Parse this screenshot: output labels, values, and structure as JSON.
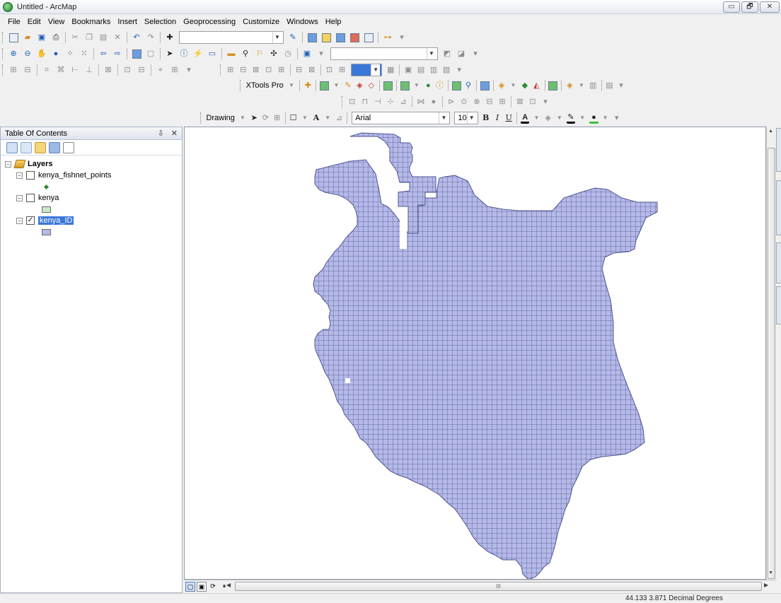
{
  "window": {
    "title": "Untitled - ArcMap",
    "controls": [
      "▭",
      "🗗",
      "✕"
    ]
  },
  "menu": [
    "File",
    "Edit",
    "View",
    "Bookmarks",
    "Insert",
    "Selection",
    "Geoprocessing",
    "Customize",
    "Windows",
    "Help"
  ],
  "toolbars": {
    "scale_combo_value": "",
    "xtools_label": "XTools Pro",
    "drawing_label": "Drawing",
    "font_name": "Arial",
    "font_size": "10",
    "bold": "B",
    "italic": "I",
    "underline": "U",
    "font_color_glyph": "A",
    "ellipsis": "..."
  },
  "toc": {
    "title": "Table Of Contents",
    "pin": "⇩",
    "close": "✕",
    "root": {
      "label": "Layers",
      "expander": "−"
    },
    "layers": [
      {
        "name": "kenya_fishnet_points",
        "checked": false,
        "expander": "−",
        "legend": "point",
        "color": "#2d8a2d"
      },
      {
        "name": "kenya",
        "checked": false,
        "expander": "−",
        "legend": "polygon",
        "color": "#c9eac5"
      },
      {
        "name": "kenya_ID",
        "checked": true,
        "expander": "−",
        "legend": "polygon",
        "color": "#b5b9e8",
        "selected": true
      }
    ]
  },
  "map": {
    "fill": "#b5b9e8",
    "stroke": "#4f5690"
  },
  "scroll": {
    "hthumb_grip": "III"
  },
  "status": {
    "coordinates": "44.133  3.871 Decimal Degrees"
  }
}
